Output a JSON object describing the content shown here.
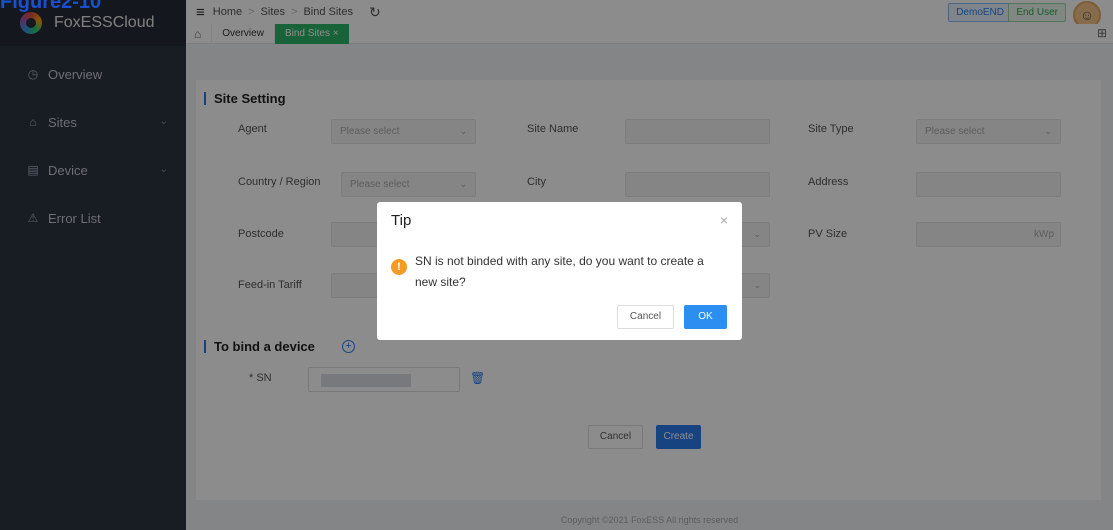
{
  "figure_label": "Figure2-10",
  "app": {
    "name": "FoxESSCloud"
  },
  "sidebar": {
    "items": [
      {
        "label": "Overview",
        "icon": "clock-icon"
      },
      {
        "label": "Sites",
        "icon": "sites-icon"
      },
      {
        "label": "Device",
        "icon": "device-icon"
      },
      {
        "label": "Error List",
        "icon": "error-icon"
      }
    ]
  },
  "breadcrumb": [
    "Home",
    "Sites",
    "Bind Sites"
  ],
  "header": {
    "role_tag": "DemoEND",
    "user_tag": "End User"
  },
  "tabs": {
    "overview": "Overview",
    "bind_sites": "Bind Sites ×"
  },
  "site_setting": {
    "title": "Site Setting",
    "agent": {
      "label": "Agent",
      "placeholder": "Please select"
    },
    "site_name": {
      "label": "Site Name"
    },
    "site_type": {
      "label": "Site Type",
      "placeholder": "Please select"
    },
    "country": {
      "label": "Country / Region",
      "placeholder": "Please select"
    },
    "city": {
      "label": "City"
    },
    "address": {
      "label": "Address"
    },
    "postcode": {
      "label": "Postcode"
    },
    "pv_size": {
      "label": "PV Size",
      "unit": "kWp"
    },
    "feed_in": {
      "label": "Feed-in Tariff"
    }
  },
  "bind_device": {
    "title": "To bind a device",
    "sn_label": "* SN"
  },
  "actions": {
    "cancel": "Cancel",
    "create": "Create"
  },
  "footer": "Copyright ©2021 FoxESS All rights reserved",
  "modal": {
    "title": "Tip",
    "close": "×",
    "message": "SN is not binded with any site, do you want to create a new site?",
    "cancel": "Cancel",
    "ok": "OK"
  },
  "colors": {
    "accent": "#2b7ce9",
    "tab_active": "#2fb56a",
    "warning": "#f59a23",
    "sidebar": "#2c3340"
  }
}
